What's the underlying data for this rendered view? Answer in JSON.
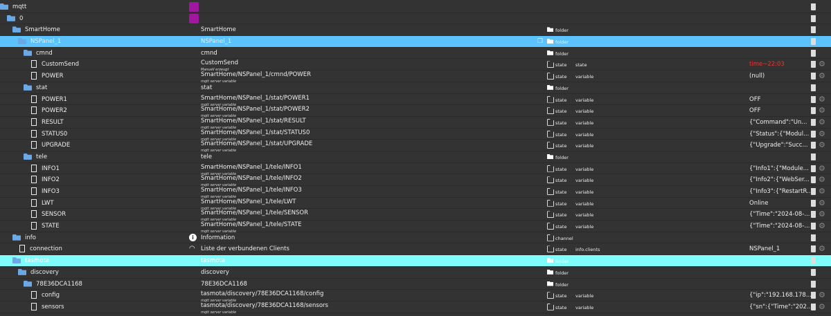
{
  "rows": [
    {
      "name": "mqtt",
      "level": 0,
      "kind": "folder",
      "adapter": true,
      "col2": "",
      "type": "",
      "role": "",
      "value": ""
    },
    {
      "name": "0",
      "level": 1,
      "kind": "folder",
      "adapter": true,
      "col2": "",
      "type": "",
      "role": "",
      "value": ""
    },
    {
      "name": "SmartHome",
      "level": 2,
      "kind": "folder",
      "col2": "SmartHome",
      "type": "folder",
      "role": "",
      "value": ""
    },
    {
      "name": "NSPanel_1",
      "level": 3,
      "kind": "folder",
      "col2": "NSPanel_1",
      "type": "folder",
      "role": "",
      "value": "",
      "selected": true
    },
    {
      "name": "cmnd",
      "level": 4,
      "kind": "folder",
      "col2": "cmnd",
      "type": "folder",
      "role": "",
      "value": ""
    },
    {
      "name": "CustomSend",
      "level": 5,
      "kind": "file",
      "col2": "CustomSend",
      "sub": "Manuell erzeugt",
      "type": "state",
      "role": "state",
      "value": "time~22:03",
      "valueColor": "#e53935"
    },
    {
      "name": "POWER",
      "level": 5,
      "kind": "file",
      "col2": "SmartHome/NSPanel_1/cmnd/POWER",
      "sub": "mqtt server variable",
      "type": "state",
      "role": "variable",
      "value": "(null)"
    },
    {
      "name": "stat",
      "level": 4,
      "kind": "folder",
      "col2": "stat",
      "type": "folder",
      "role": "",
      "value": ""
    },
    {
      "name": "POWER1",
      "level": 5,
      "kind": "file",
      "col2": "SmartHome/NSPanel_1/stat/POWER1",
      "sub": "mqtt server variable",
      "type": "state",
      "role": "variable",
      "value": "OFF"
    },
    {
      "name": "POWER2",
      "level": 5,
      "kind": "file",
      "col2": "SmartHome/NSPanel_1/stat/POWER2",
      "sub": "mqtt server variable",
      "type": "state",
      "role": "variable",
      "value": "OFF"
    },
    {
      "name": "RESULT",
      "level": 5,
      "kind": "file",
      "col2": "SmartHome/NSPanel_1/stat/RESULT",
      "sub": "mqtt server variable",
      "type": "state",
      "role": "variable",
      "value": "{\"Command\":\"Un..."
    },
    {
      "name": "STATUS0",
      "level": 5,
      "kind": "file",
      "col2": "SmartHome/NSPanel_1/stat/STATUS0",
      "sub": "mqtt server variable",
      "type": "state",
      "role": "variable",
      "value": "{\"Status\":{\"Modul..."
    },
    {
      "name": "UPGRADE",
      "level": 5,
      "kind": "file",
      "col2": "SmartHome/NSPanel_1/stat/UPGRADE",
      "sub": "mqtt server variable",
      "type": "state",
      "role": "variable",
      "value": "{\"Upgrade\":\"Succ..."
    },
    {
      "name": "tele",
      "level": 4,
      "kind": "folder",
      "col2": "tele",
      "type": "folder",
      "role": "",
      "value": ""
    },
    {
      "name": "INFO1",
      "level": 5,
      "kind": "file",
      "col2": "SmartHome/NSPanel_1/tele/INFO1",
      "sub": "mqtt server variable",
      "type": "state",
      "role": "variable",
      "value": "{\"Info1\":{\"Module..."
    },
    {
      "name": "INFO2",
      "level": 5,
      "kind": "file",
      "col2": "SmartHome/NSPanel_1/tele/INFO2",
      "sub": "mqtt server variable",
      "type": "state",
      "role": "variable",
      "value": "{\"Info2\":{\"WebSer..."
    },
    {
      "name": "INFO3",
      "level": 5,
      "kind": "file",
      "col2": "SmartHome/NSPanel_1/tele/INFO3",
      "sub": "mqtt server variable",
      "type": "state",
      "role": "variable",
      "value": "{\"Info3\":{\"RestartR..."
    },
    {
      "name": "LWT",
      "level": 5,
      "kind": "file",
      "col2": "SmartHome/NSPanel_1/tele/LWT",
      "sub": "mqtt server variable",
      "type": "state",
      "role": "variable",
      "value": "Online"
    },
    {
      "name": "SENSOR",
      "level": 5,
      "kind": "file",
      "col2": "SmartHome/NSPanel_1/tele/SENSOR",
      "sub": "mqtt server variable",
      "type": "state",
      "role": "variable",
      "value": "{\"Time\":\"2024-08-..."
    },
    {
      "name": "STATE",
      "level": 5,
      "kind": "file",
      "col2": "SmartHome/NSPanel_1/tele/STATE",
      "sub": "mqtt server variable",
      "type": "state",
      "role": "variable",
      "value": "{\"Time\":\"2024-08-..."
    },
    {
      "name": "info",
      "level": 2,
      "kind": "folder",
      "col2": "Information",
      "col2icon": "info",
      "type": "channel",
      "role": "",
      "value": ""
    },
    {
      "name": "connection",
      "level": 3,
      "kind": "file",
      "col2": "Liste der verbundenen Clients",
      "col2icon": "wifi",
      "type": "state",
      "role": "info.clients",
      "value": "NSPanel_1"
    },
    {
      "name": "tasmota",
      "level": 2,
      "kind": "folder",
      "col2": "tasmota",
      "type": "folder",
      "role": "",
      "value": "",
      "selected2": true
    },
    {
      "name": "discovery",
      "level": 3,
      "kind": "folder",
      "col2": "discovery",
      "type": "folder",
      "role": "",
      "value": ""
    },
    {
      "name": "78E36DCA1168",
      "level": 4,
      "kind": "folder",
      "col2": "78E36DCA1168",
      "type": "folder",
      "role": "",
      "value": ""
    },
    {
      "name": "config",
      "level": 5,
      "kind": "file",
      "col2": "tasmota/discovery/78E36DCA1168/config",
      "sub": "mqtt server variable",
      "type": "state",
      "role": "variable",
      "value": "{\"ip\":\"192.168.178..."
    },
    {
      "name": "sensors",
      "level": 5,
      "kind": "file",
      "col2": "tasmota/discovery/78E36DCA1168/sensors",
      "sub": "mqtt server variable",
      "type": "state",
      "role": "variable",
      "value": "{\"sn\":{\"Time\":\"202..."
    }
  ]
}
